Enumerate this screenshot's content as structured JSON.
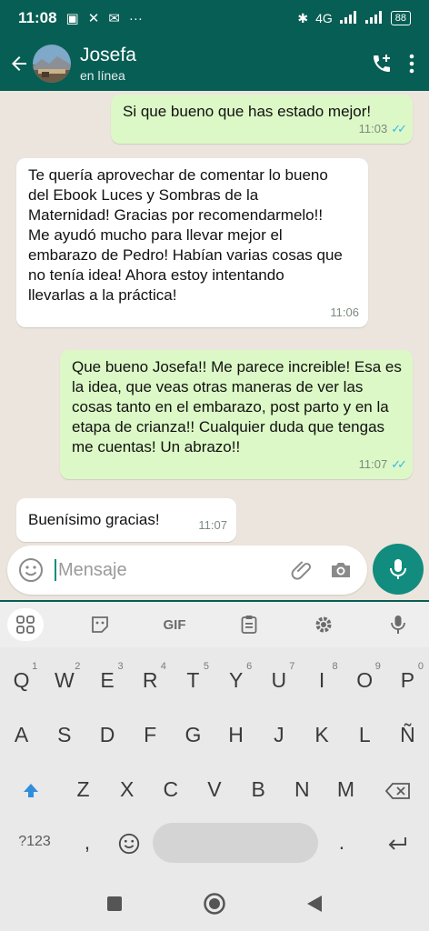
{
  "status_bar": {
    "time": "11:08",
    "network": "4G",
    "battery": "88"
  },
  "header": {
    "contact_name": "Josefa",
    "contact_status": "en línea"
  },
  "messages": [
    {
      "direction": "out",
      "text": "Si que bueno que has estado mejor!",
      "time": "11:03",
      "read": true
    },
    {
      "direction": "in",
      "text": "Te quería aprovechar de comentar lo bueno del Ebook  Luces y Sombras de la Maternidad! Gracias por recomendarmelo!! Me ayudó mucho para llevar mejor el embarazo de Pedro! Habían varias cosas que no tenía idea! Ahora estoy intentando llevarlas a la práctica!",
      "time": "11:06"
    },
    {
      "direction": "out",
      "text": "Que bueno Josefa!! Me parece increible! Esa es la idea, que veas otras maneras de ver las cosas tanto en el embarazo, post parto y en la etapa de crianza!! Cualquier duda que tengas me cuentas! Un abrazo!!",
      "time": "11:07",
      "read": true
    },
    {
      "direction": "in",
      "text": "Buenísimo gracias!",
      "time": "11:07"
    }
  ],
  "compose": {
    "placeholder": "Mensaje"
  },
  "keyboard": {
    "toolbar": {
      "gif_label": "GIF"
    },
    "row1": [
      {
        "key": "Q",
        "hint": "1"
      },
      {
        "key": "W",
        "hint": "2"
      },
      {
        "key": "E",
        "hint": "3"
      },
      {
        "key": "R",
        "hint": "4"
      },
      {
        "key": "T",
        "hint": "5"
      },
      {
        "key": "Y",
        "hint": "6"
      },
      {
        "key": "U",
        "hint": "7"
      },
      {
        "key": "I",
        "hint": "8"
      },
      {
        "key": "O",
        "hint": "9"
      },
      {
        "key": "P",
        "hint": "0"
      }
    ],
    "row2": [
      "A",
      "S",
      "D",
      "F",
      "G",
      "H",
      "J",
      "K",
      "L",
      "Ñ"
    ],
    "row3": [
      "Z",
      "X",
      "C",
      "V",
      "B",
      "N",
      "M"
    ],
    "numbers_key": "?123",
    "comma_key": ",",
    "period_key": "."
  },
  "colors": {
    "header": "#075e54",
    "outgoing_bubble": "#dcf8c6",
    "incoming_bubble": "#ffffff",
    "chat_background": "#ece5dd",
    "accent": "#128c7e",
    "read_ticks": "#34b7f1"
  }
}
